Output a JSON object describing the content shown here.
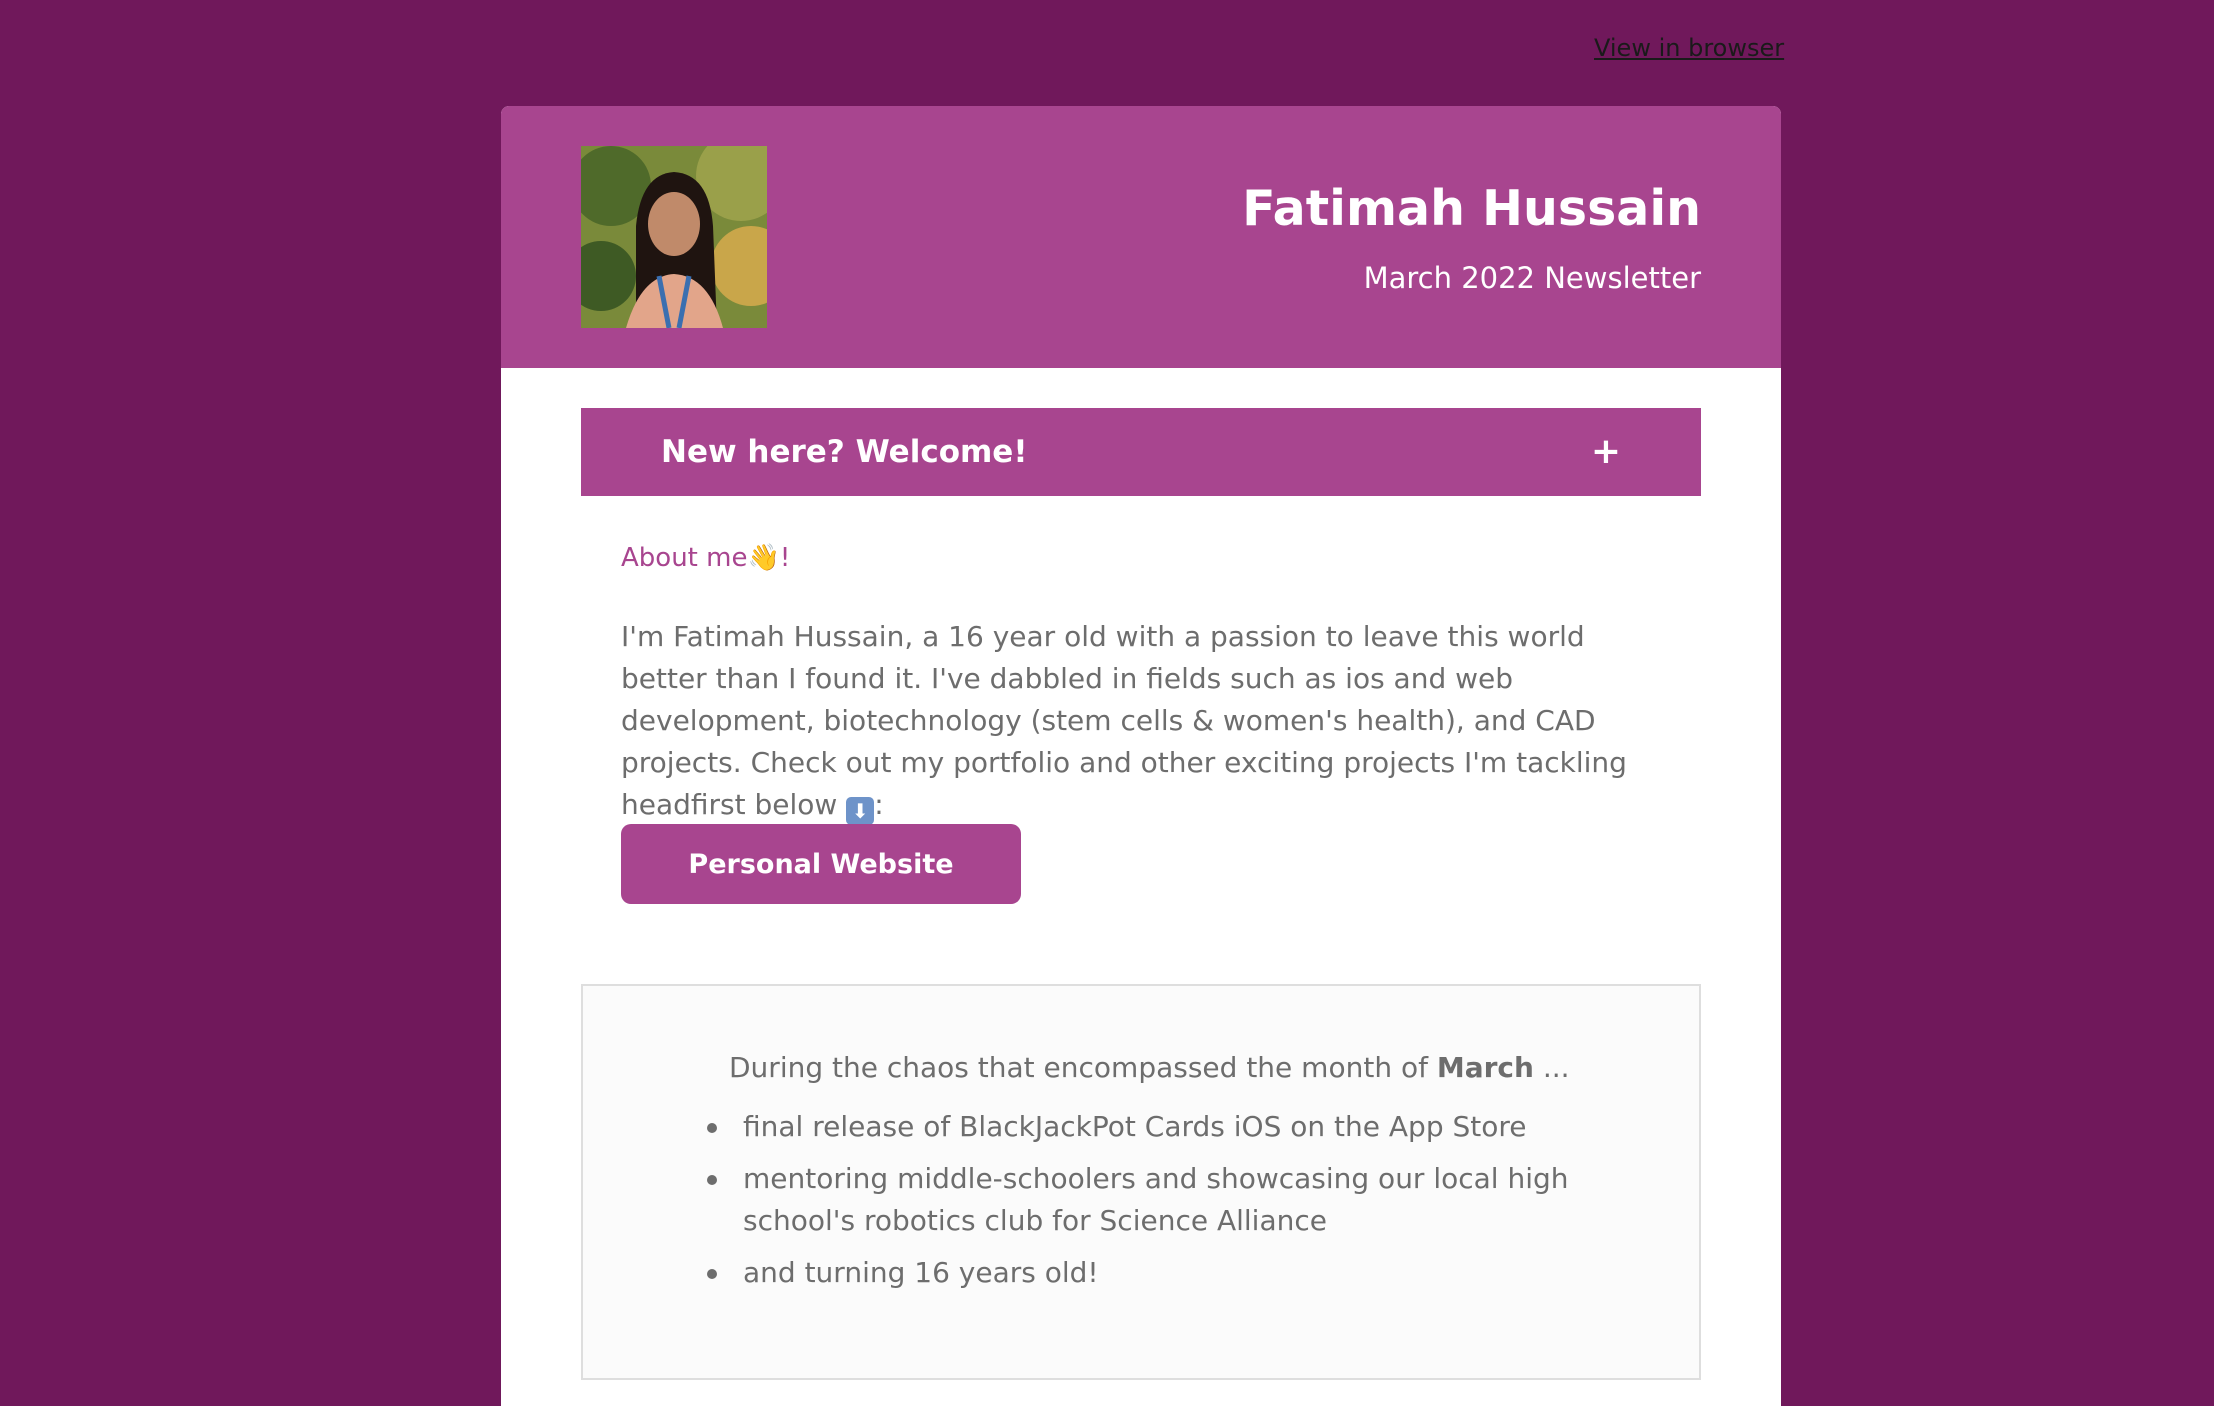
{
  "top": {
    "view_in_browser": "View in browser"
  },
  "header": {
    "name": "Fatimah Hussain",
    "subtitle": "March 2022 Newsletter"
  },
  "welcome": {
    "title": "New here? Welcome!",
    "toggle": "+"
  },
  "about": {
    "heading": "About me",
    "wave": "👋",
    "exclaim": "!",
    "bio": "I'm Fatimah Hussain, a 16 year old with a passion to leave this world better than I found it. I've dabbled in fields such as ios and web development, biotechnology (stem cells & women's health), and CAD projects. Check out my portfolio and other exciting projects I'm tackling headfirst below ",
    "arrow": "⬇",
    "colon": ":",
    "button": "Personal Website"
  },
  "march": {
    "intro_prefix": "During the chaos that encompassed the month of ",
    "intro_bold": "March",
    "intro_suffix": " ...",
    "items": [
      "final release of BlackJackPot Cards iOS on the App Store",
      "mentoring middle-schoolers and showcasing our local high school's robotics club for Science Alliance",
      "and turning 16 years old!"
    ]
  },
  "colors": {
    "background": "#70185b",
    "accent": "#a8458f",
    "text": "#6d6d6d"
  }
}
